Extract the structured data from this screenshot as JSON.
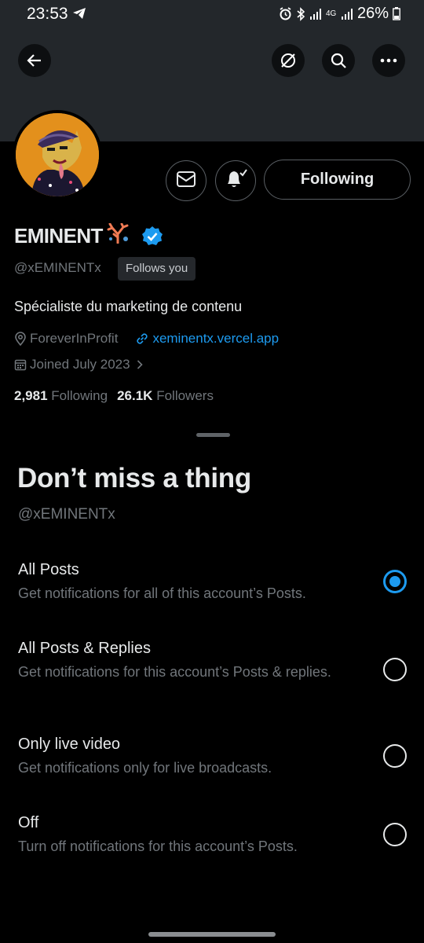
{
  "status_bar": {
    "time": "23:53",
    "battery": "26%",
    "network_label": "4G"
  },
  "toolbar": {
    "back_icon": "arrow-left-icon",
    "hide_icon": "eye-slash-icon",
    "search_icon": "search-icon",
    "more_icon": "more-horizontal-icon"
  },
  "profile": {
    "display_name": "EMINENT",
    "handle": "@xEMINENTx",
    "follows_you": "Follows you",
    "following_button": "Following",
    "bio": "Spécialiste du marketing de contenu",
    "location": "ForeverInProfit",
    "website": "xeminentx.vercel.app",
    "joined": "Joined July 2023",
    "following_count": "2,981",
    "following_label": "Following",
    "followers_count": "26.1K",
    "followers_label": "Followers"
  },
  "sheet": {
    "title": "Don’t miss a thing",
    "handle": "@xEMINENTx",
    "options": [
      {
        "label": "All Posts",
        "description": "Get notifications for all of this account’s Posts.",
        "selected": true
      },
      {
        "label": "All Posts & Replies",
        "description": "Get notifications for this account’s Posts & replies.",
        "selected": false
      },
      {
        "label": "Only live video",
        "description": "Get notifications only for live broadcasts.",
        "selected": false
      },
      {
        "label": "Off",
        "description": "Turn off notifications for this account’s Posts.",
        "selected": false
      }
    ]
  },
  "colors": {
    "accent": "#1d9bf0",
    "background": "#000000",
    "banner": "#23272b",
    "secondary_text": "#71767b"
  }
}
